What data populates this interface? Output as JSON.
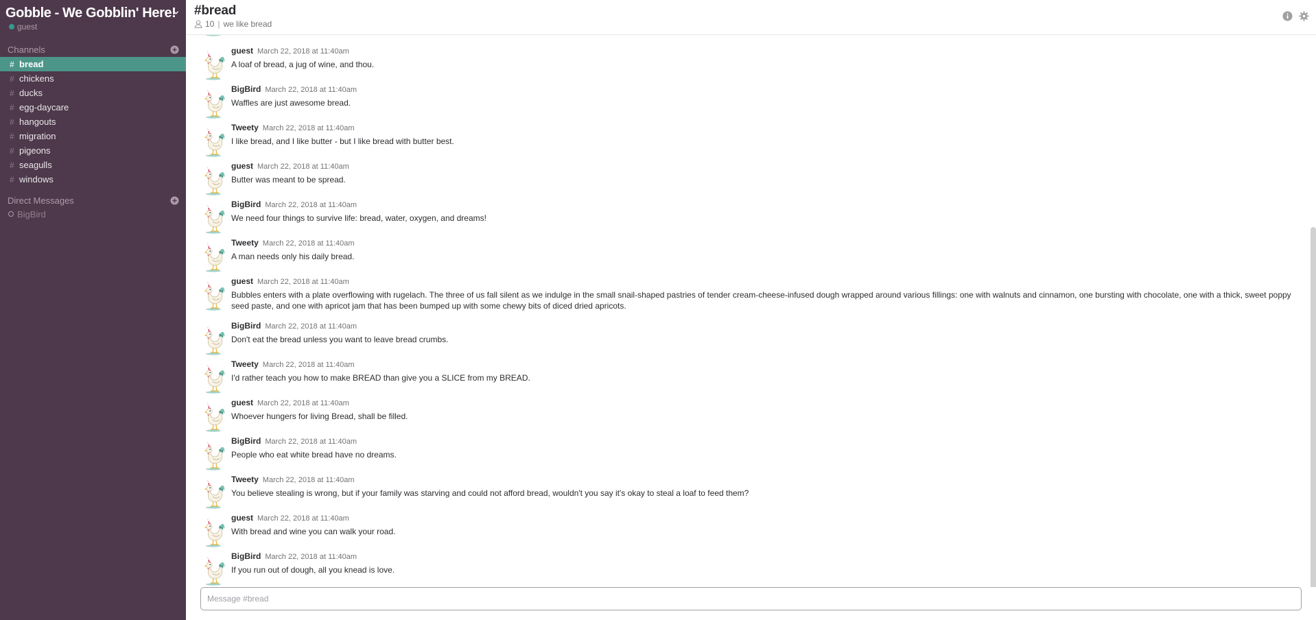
{
  "team": {
    "name": "Gobble - We Gobblin' Here!",
    "current_user": "guest"
  },
  "sidebar": {
    "channels_label": "Channels",
    "channels": [
      {
        "name": "bread",
        "active": true
      },
      {
        "name": "chickens",
        "active": false
      },
      {
        "name": "ducks",
        "active": false
      },
      {
        "name": "egg-daycare",
        "active": false
      },
      {
        "name": "hangouts",
        "active": false
      },
      {
        "name": "migration",
        "active": false
      },
      {
        "name": "pigeons",
        "active": false
      },
      {
        "name": "seagulls",
        "active": false
      },
      {
        "name": "windows",
        "active": false
      }
    ],
    "dm_label": "Direct Messages",
    "direct_messages": [
      {
        "name": "BigBird",
        "online": false
      }
    ]
  },
  "channel": {
    "title": "#bread",
    "member_count": "10",
    "separator": "|",
    "topic": "we like bread"
  },
  "messages": [
    {
      "author": "guest",
      "time": "March 22, 2018 at 11:40am",
      "text": "A loaf of bread, a jug of wine, and thou."
    },
    {
      "author": "BigBird",
      "time": "March 22, 2018 at 11:40am",
      "text": "Waffles are just awesome bread."
    },
    {
      "author": "Tweety",
      "time": "March 22, 2018 at 11:40am",
      "text": "I like bread, and I like butter - but I like bread with butter best."
    },
    {
      "author": "guest",
      "time": "March 22, 2018 at 11:40am",
      "text": "Butter was meant to be spread."
    },
    {
      "author": "BigBird",
      "time": "March 22, 2018 at 11:40am",
      "text": "We need four things to survive life: bread, water, oxygen, and dreams!"
    },
    {
      "author": "Tweety",
      "time": "March 22, 2018 at 11:40am",
      "text": "A man needs only his daily bread."
    },
    {
      "author": "guest",
      "time": "March 22, 2018 at 11:40am",
      "text": "Bubbles enters with a plate overflowing with rugelach. The three of us fall silent as we indulge in the small snail-shaped pastries of tender cream-cheese-infused dough wrapped around various fillings: one with walnuts and cinnamon, one bursting with chocolate, one with a thick, sweet poppy seed paste, and one with apricot jam that has been bumped up with some chewy bits of diced dried apricots."
    },
    {
      "author": "BigBird",
      "time": "March 22, 2018 at 11:40am",
      "text": "Don't eat the bread unless you want to leave bread crumbs."
    },
    {
      "author": "Tweety",
      "time": "March 22, 2018 at 11:40am",
      "text": "I'd rather teach you how to make BREAD than give you a SLICE from my BREAD."
    },
    {
      "author": "guest",
      "time": "March 22, 2018 at 11:40am",
      "text": "Whoever hungers for living Bread, shall be filled."
    },
    {
      "author": "BigBird",
      "time": "March 22, 2018 at 11:40am",
      "text": "People who eat white bread have no dreams."
    },
    {
      "author": "Tweety",
      "time": "March 22, 2018 at 11:40am",
      "text": "You believe stealing is wrong, but if your family was starving and could not afford bread, wouldn't you say it's okay to steal a loaf to feed them?"
    },
    {
      "author": "guest",
      "time": "March 22, 2018 at 11:40am",
      "text": "With bread and wine you can walk your road."
    },
    {
      "author": "BigBird",
      "time": "March 22, 2018 at 11:40am",
      "text": "If you run out of dough, all you knead is love."
    }
  ],
  "composer": {
    "placeholder": "Message #bread"
  },
  "icons": {
    "team_menu": "chevron-down-icon",
    "add_channel": "plus-circle-icon",
    "add_dm": "plus-circle-icon",
    "members": "person-icon",
    "info": "info-icon",
    "settings": "gear-icon",
    "avatar": "rooster-avatar"
  },
  "colors": {
    "sidebar_bg": "#4d394b",
    "active_channel": "#4c9689",
    "presence_online": "#38978d"
  }
}
